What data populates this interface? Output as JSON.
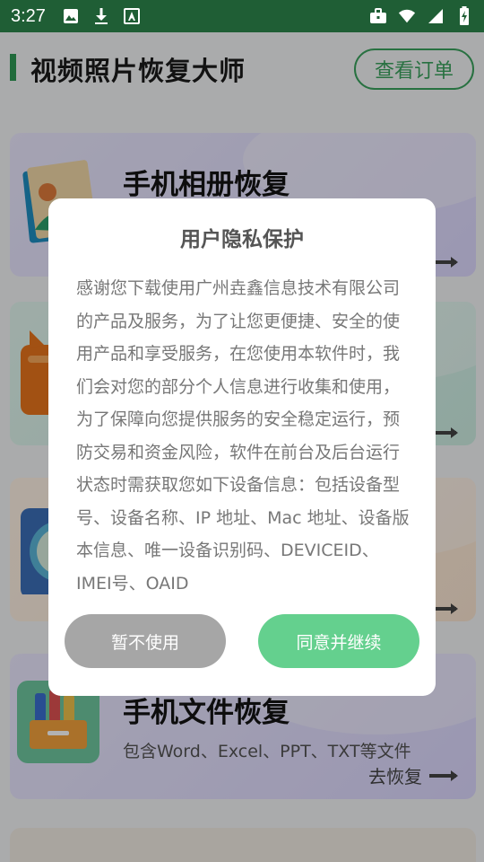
{
  "status_bar": {
    "time": "3:27",
    "left_icons": [
      "image-icon",
      "download-icon",
      "font-icon"
    ],
    "right_icons": [
      "briefcase-icon",
      "wifi-icon",
      "signal-icon",
      "battery-icon"
    ]
  },
  "header": {
    "title": "视频照片恢复大师",
    "order_button": "查看订单"
  },
  "cards": [
    {
      "title": "手机相册恢复",
      "desc": "",
      "action": ""
    },
    {
      "title": "",
      "desc": "",
      "action": ""
    },
    {
      "title": "",
      "desc": "",
      "action": ""
    },
    {
      "title": "手机文件恢复",
      "desc": "包含Word、Excel、PPT、TXT等文件",
      "action": "去恢复"
    }
  ],
  "dialog": {
    "title": "用户隐私保护",
    "body": "感谢您下载使用广州垚鑫信息技术有限公司的产品及服务，为了让您更便捷、安全的使用产品和享受服务，在您使用本软件时，我们会对您的部分个人信息进行收集和使用，为了保障向您提供服务的安全稳定运行，预防交易和资金风险，软件在前台及后台运行状态时需获取您如下设备信息：包括设备型号、设备名称、IP 地址、Mac 地址、设备版本信息、唯一设备识别码、DEVICEID、IMEI号、OAID",
    "decline_button": "暂不使用",
    "agree_button": "同意并继续"
  },
  "colors": {
    "status_bar": "#1f5e35",
    "accent_green": "#3aa35d",
    "agree_green": "#64d08e",
    "decline_gray": "#a6a6a6"
  }
}
